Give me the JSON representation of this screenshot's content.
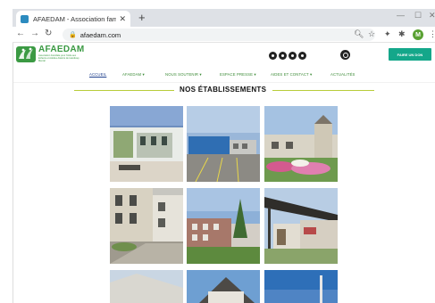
{
  "browser": {
    "tab_title": "AFAEDAM - Association familiale",
    "url": "afaedam.com",
    "profile_initial": "M"
  },
  "site": {
    "logo_name": "AFAEDAM",
    "logo_tagline": "Association Familiale pour l'Aide aux Enfants et Adultes Atteints de Handicap Mental",
    "donate_label": "FAIRE UN DON",
    "menu": [
      {
        "label": "ACCUEIL",
        "active": true
      },
      {
        "label": "AFAEDAM ▾",
        "active": false
      },
      {
        "label": "NOUS SOUTENIR ▾",
        "active": false
      },
      {
        "label": "ESPACE PRESSE ▾",
        "active": false
      },
      {
        "label": "AIDES ET CONTACT ▾",
        "active": false
      },
      {
        "label": "ACTUALITÉS",
        "active": false
      }
    ],
    "section_title": "NOS ÉTABLISSEMENTS",
    "colors": {
      "brand_green": "#3b9a43",
      "donate_teal": "#14a78a",
      "accent_line": "#b8cc3a",
      "menu_active": "#1e3f8c"
    }
  }
}
